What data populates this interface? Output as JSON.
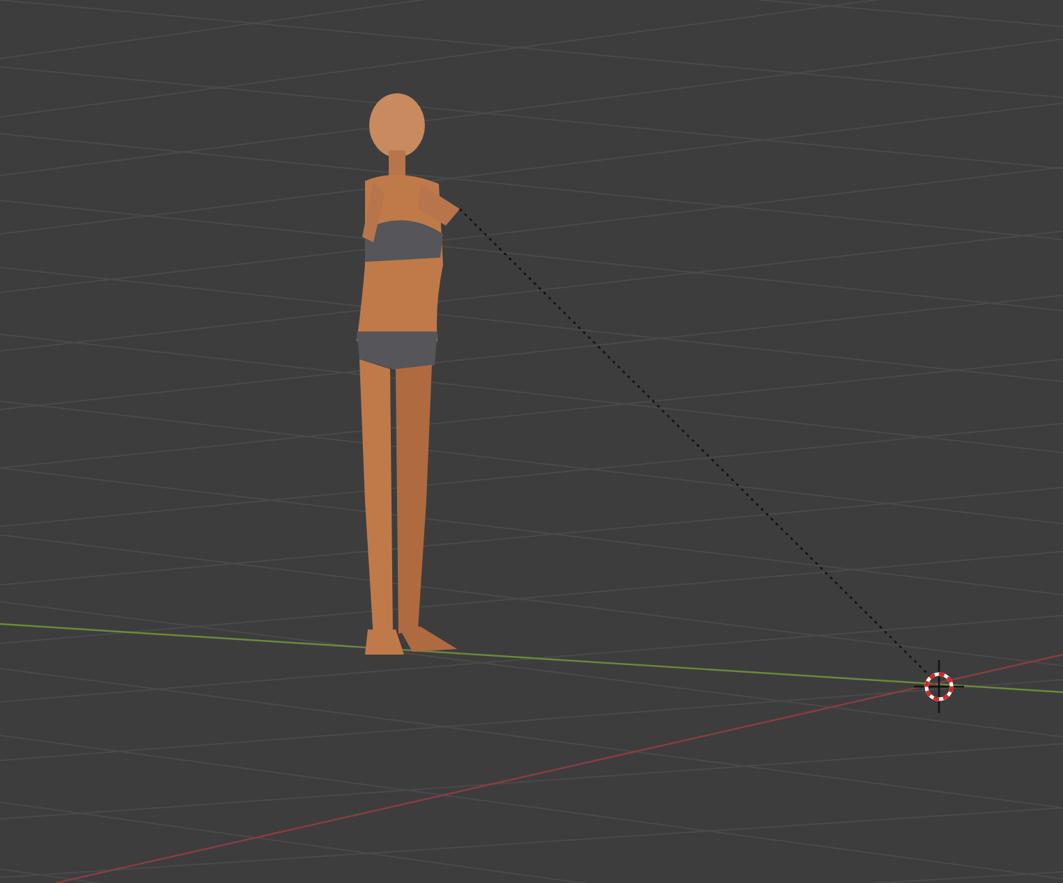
{
  "viewport": {
    "grid_visible": true,
    "cursor_visible": true
  }
}
